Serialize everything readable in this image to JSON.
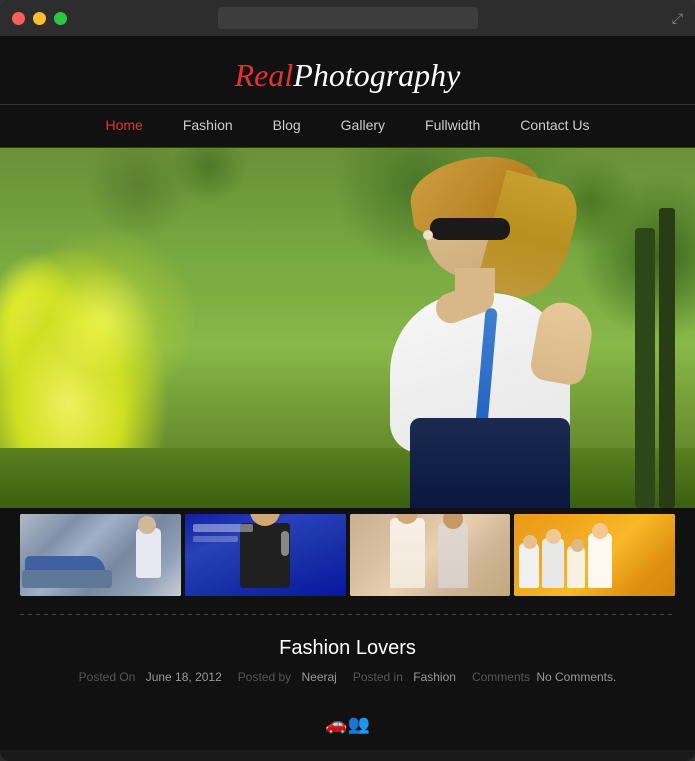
{
  "window": {
    "title": "",
    "titlebar": {
      "close": "close",
      "minimize": "minimize",
      "maximize": "maximize",
      "fullscreen_icon": "⤢"
    }
  },
  "site": {
    "logo": {
      "part1": "Real",
      "part2": "Photography"
    },
    "nav": {
      "items": [
        {
          "label": "Home",
          "active": true
        },
        {
          "label": "Fashion",
          "active": false
        },
        {
          "label": "Blog",
          "active": false
        },
        {
          "label": "Gallery",
          "active": false
        },
        {
          "label": "Fullwidth",
          "active": false
        },
        {
          "label": "Contact Us",
          "active": false
        }
      ]
    },
    "post": {
      "title": "Fashion Lovers",
      "meta": {
        "posted_on_label": "Posted On",
        "date": "June 18, 2012",
        "posted_by_label": "Posted by",
        "author": "Neeraj",
        "posted_in_label": "Posted in",
        "category": "Fashion",
        "comments_label": "Comments",
        "comments_count": "No Comments."
      },
      "icons": "🚗👥"
    },
    "thumbnails": [
      {
        "id": 1,
        "alt": "Man with car"
      },
      {
        "id": 2,
        "alt": "Woman with microphone"
      },
      {
        "id": 3,
        "alt": "Fashion walk"
      },
      {
        "id": 4,
        "alt": "Crowd scene"
      }
    ]
  }
}
